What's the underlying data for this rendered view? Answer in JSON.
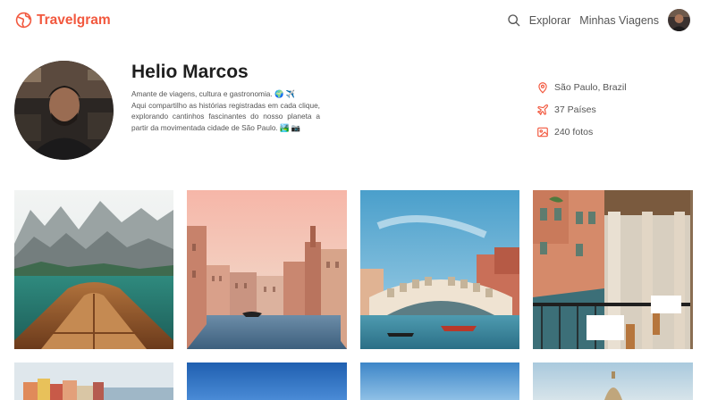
{
  "header": {
    "logo_text": "Travelgram",
    "nav": [
      {
        "label": "Explorar"
      },
      {
        "label": "Minhas Viagens"
      }
    ]
  },
  "profile": {
    "name": "Helio Marcos",
    "bio": [
      "Amante de viagens, cultura e gastronomia. 🌍 ✈️",
      "Aqui compartilho as histórias registradas em cada clique, explorando cantinhos fascinantes do nosso planeta a partir da movimentada cidade de São Paulo. 🏞️ 📷"
    ],
    "stats": [
      {
        "icon": "location-pin-icon",
        "text": "São Paulo, Brazil"
      },
      {
        "icon": "airplane-icon",
        "text": "37 Países"
      },
      {
        "icon": "image-icon",
        "text": "240 fotos"
      }
    ]
  },
  "colors": {
    "brand": "#f2583e",
    "text_muted": "#555555",
    "title": "#1e1e1e"
  },
  "gallery": {
    "photos": [
      {
        "subject": "lake-boat-mountains"
      },
      {
        "subject": "venice-grand-canal"
      },
      {
        "subject": "rialto-bridge"
      },
      {
        "subject": "venice-restaurant-terrace"
      },
      {
        "subject": "coastal-village"
      },
      {
        "subject": "blue-sky"
      },
      {
        "subject": "blue-sky"
      },
      {
        "subject": "sky-dome"
      }
    ]
  }
}
